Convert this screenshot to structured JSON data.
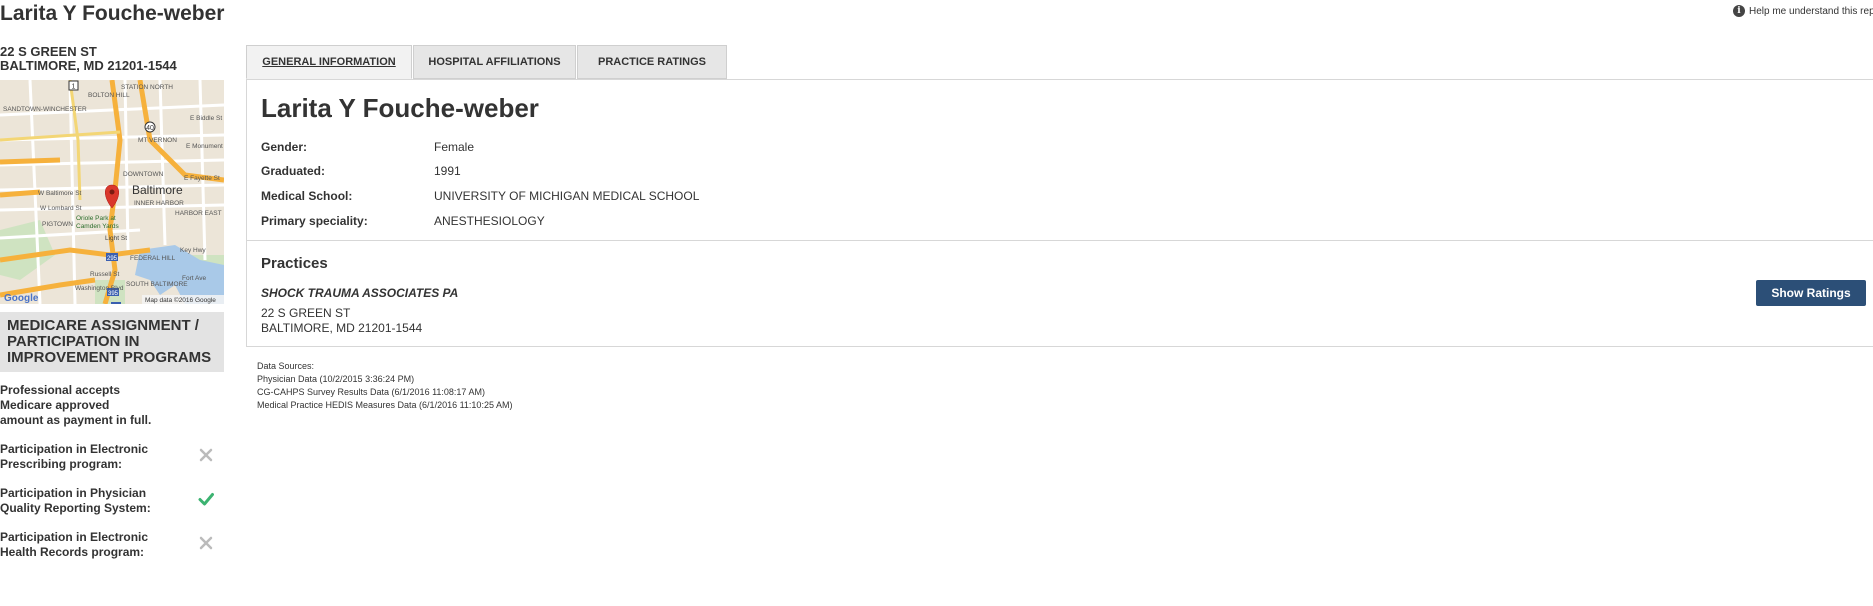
{
  "header": {
    "title": "Larita Y Fouche-weber",
    "help_text": "Help me understand this report"
  },
  "sidebar": {
    "address_line1": "22 S GREEN ST",
    "address_line2": "BALTIMORE, MD 21201-1544",
    "map": {
      "city_label": "Baltimore",
      "streets": [
        "STATION NORTH",
        "BOLTON HILL",
        "SANDTOWN-WINCHESTER",
        "MT VERNON",
        "DOWNTOWN",
        "INNER HARBOR",
        "W Baltimore St",
        "W Lombard St",
        "Oriole Park at Camden Yards",
        "E Fayette St",
        "E Monument St",
        "E Biddle St",
        "HARBOR EAST",
        "FEDERAL HILL",
        "SOUTH BALTIMORE",
        "Fort Ave",
        "Key Hwy",
        "Light St",
        "Russell St",
        "Washington Blvd",
        "PIGTOWN"
      ],
      "attribution_logo": "Google",
      "attribution": "Map data ©2016 Google",
      "route_numbers": [
        "1",
        "40",
        "295",
        "395",
        "95"
      ]
    },
    "medicare_heading": "MEDICARE ASSIGNMENT / PARTICIPATION IN IMPROVEMENT PROGRAMS",
    "accepts_text": "Professional accepts Medicare approved amount as payment in full.",
    "programs": [
      {
        "label": "Participation in Electronic Prescribing program:",
        "status": "no",
        "icon": "x-icon"
      },
      {
        "label": "Participation in Physician Quality Reporting System:",
        "status": "yes",
        "icon": "check-icon"
      },
      {
        "label": "Participation in Electronic Health Records program:",
        "status": "no",
        "icon": "x-icon"
      }
    ]
  },
  "tabs": [
    {
      "label": "GENERAL INFORMATION",
      "active": true
    },
    {
      "label": "HOSPITAL AFFILIATIONS",
      "active": false
    },
    {
      "label": "PRACTICE RATINGS",
      "active": false
    }
  ],
  "general": {
    "name": "Larita Y Fouche-weber",
    "fields": [
      {
        "label": "Gender:",
        "value": "Female"
      },
      {
        "label": "Graduated:",
        "value": "1991"
      },
      {
        "label": "Medical School:",
        "value": "UNIVERSITY OF MICHIGAN MEDICAL SCHOOL"
      },
      {
        "label": "Primary speciality:",
        "value": "ANESTHESIOLOGY"
      }
    ]
  },
  "practices": {
    "heading": "Practices",
    "items": [
      {
        "name": "SHOCK TRAUMA ASSOCIATES PA",
        "address_line1": "22 S GREEN ST",
        "address_line2": "BALTIMORE, MD 21201-1544",
        "button_label": "Show Ratings"
      }
    ]
  },
  "data_sources": {
    "title": "Data Sources:",
    "lines": [
      "Physician Data (10/2/2015 3:36:24 PM)",
      "CG-CAHPS Survey Results Data (6/1/2016 11:08:17 AM)",
      "Medical Practice HEDIS Measures Data (6/1/2016 11:10:25 AM)"
    ]
  },
  "colors": {
    "button": "#2c4f77",
    "check": "#3cb371",
    "x_mark": "#bbbbbb",
    "map_pin": "#d9372b"
  }
}
